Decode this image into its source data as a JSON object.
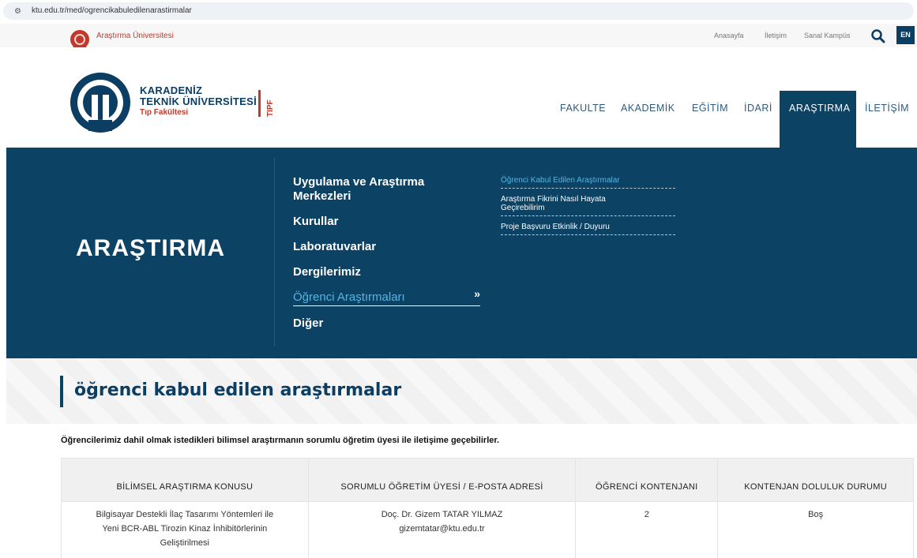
{
  "browser": {
    "url": "ktu.edu.tr/med/ogrencikabuledilenarastirmalar",
    "tune_icon": "tune-icon"
  },
  "topbar": {
    "university_tagline": "Araştırma Üniversitesi",
    "links": [
      "Anasayfa",
      "İletişim",
      "Sanal Kampüs"
    ],
    "search_icon": "search-icon",
    "lang_label": "EN"
  },
  "logo": {
    "line1": "KARADENİZ",
    "line2": "TEKNİK ÜNİVERSİTESİ",
    "line3": "Tıp Fakültesi",
    "badge": "TIPF"
  },
  "nav": {
    "items": [
      "FAKULTE",
      "AKADEMİK",
      "EĞİTİM",
      "İDARİ",
      "ARAŞTIRMA",
      "İLETİŞİM"
    ],
    "active": "ARAŞTIRMA"
  },
  "mega_menu": {
    "title": "ARAŞTIRMA",
    "links": [
      {
        "label": "Uygulama ve Araştırma Merkezleri"
      },
      {
        "label": "Kurullar"
      },
      {
        "label": "Laboratuvarlar"
      },
      {
        "label": "Dergilerimiz"
      },
      {
        "label": "Öğrenci Araştırmaları",
        "chevron": "»"
      },
      {
        "label": "Diğer"
      }
    ],
    "sublinks": [
      "Öğrenci Kabul Edilen Araştırmalar",
      "Araştırma Fikrini Nasıl Hayata Geçirebilirim",
      "Proje Başvuru Etkinlik / Duyuru"
    ]
  },
  "page": {
    "title": "öğrenci kabul edilen araştırmalar",
    "intro": "Öğrencilerimiz dahil olmak istedikleri bilimsel araştırmanın sorumlu öğretim üyesi ile iletişime geçebilirler."
  },
  "table": {
    "headers": [
      "BİLİMSEL ARAŞTIRMA KONUSU",
      "SORUMLU ÖĞRETİM ÜYESİ / E-POSTA ADRESİ",
      "ÖĞRENCİ KONTENJANI",
      "KONTENJAN DOLULUK DURUMU"
    ],
    "rows": [
      {
        "topic_lines": [
          "Bilgisayar Destekli İlaç Tasarımı Yöntemleri ile",
          "Yeni BCR-ABL Tirozin Kinaz İnhibitörlerinin",
          "Geliştirilmesi"
        ],
        "advisor": "Doç. Dr. Gizem TATAR YILMAZ",
        "email": "gizemtatar@ktu.edu.tr",
        "quota": "2",
        "status": "Boş"
      }
    ]
  },
  "colors": {
    "navy": "#0c4264",
    "accent_red": "#c0392b",
    "link_blue": "#56b4e3"
  }
}
